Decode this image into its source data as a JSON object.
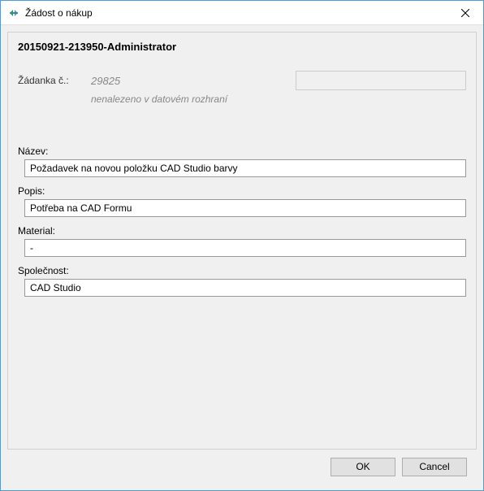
{
  "window": {
    "title": "Žádost o nákup"
  },
  "header": {
    "identifier": "20150921-213950-Administrator"
  },
  "request": {
    "label": "Žádanka č.:",
    "number": "29825",
    "notFound": "nenalezeno v datovém rozhraní"
  },
  "fields": {
    "name": {
      "label": "Název:",
      "value": "Požadavek na novou položku CAD Studio barvy"
    },
    "description": {
      "label": "Popis:",
      "value": "Potřeba na CAD Formu"
    },
    "material": {
      "label": "Material:",
      "value": "-"
    },
    "company": {
      "label": "Společnost:",
      "value": "CAD Studio"
    }
  },
  "buttons": {
    "ok": "OK",
    "cancel": "Cancel"
  }
}
